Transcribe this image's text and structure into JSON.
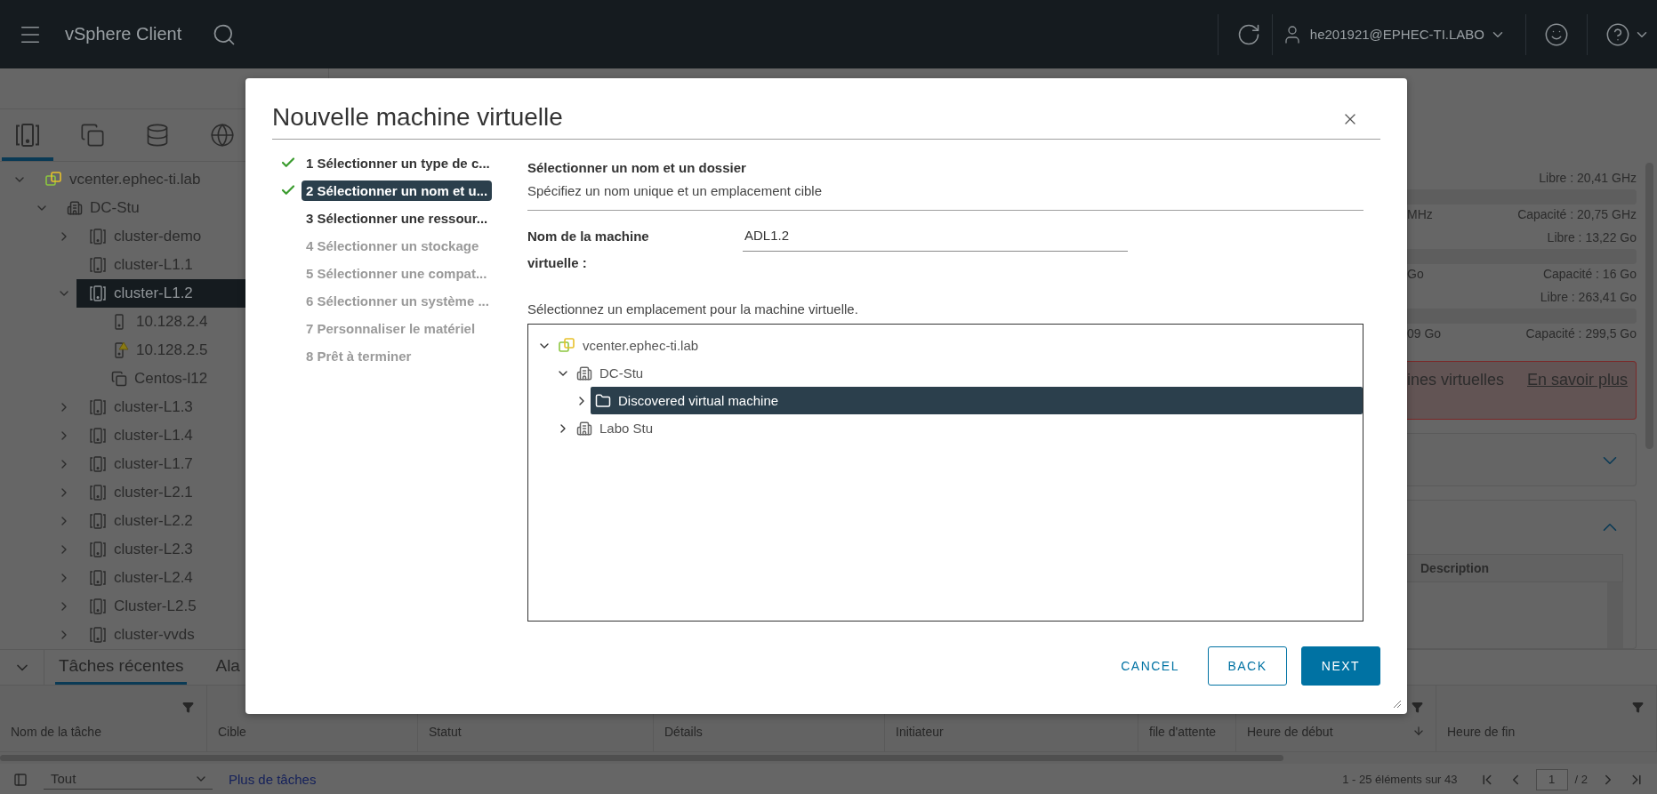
{
  "header": {
    "title": "vSphere Client",
    "user": "he201921@EPHEC-TI.LABO"
  },
  "sidebar": {
    "tabs": [
      {
        "kind": "hosts",
        "selected": true
      },
      {
        "kind": "vms",
        "selected": false
      },
      {
        "kind": "storage",
        "selected": false
      },
      {
        "kind": "network",
        "selected": false
      }
    ],
    "tree": [
      {
        "label": "vcenter.ephec-ti.lab",
        "kind": "vcenter",
        "expanded": true,
        "selected": false,
        "children": [
          {
            "label": "DC-Stu",
            "kind": "datacenter",
            "expanded": true,
            "selected": false,
            "children": [
              {
                "label": "cluster-demo",
                "kind": "cluster",
                "expanded": false,
                "selected": false
              },
              {
                "label": "cluster-L1.1",
                "kind": "cluster",
                "selected": false
              },
              {
                "label": "cluster-L1.2",
                "kind": "cluster",
                "expanded": true,
                "selected": true,
                "children": [
                  {
                    "label": "10.128.2.4",
                    "kind": "host",
                    "selected": false
                  },
                  {
                    "label": "10.128.2.5",
                    "kind": "host-warning",
                    "selected": false
                  },
                  {
                    "label": "Centos-l12",
                    "kind": "vm",
                    "selected": false
                  }
                ]
              },
              {
                "label": "cluster-L1.3",
                "kind": "cluster",
                "expanded": false,
                "selected": false
              },
              {
                "label": "cluster-L1.4",
                "kind": "cluster",
                "expanded": false,
                "selected": false
              },
              {
                "label": "cluster-L1.7",
                "kind": "cluster",
                "expanded": false,
                "selected": false
              },
              {
                "label": "cluster-L2.1",
                "kind": "cluster",
                "expanded": false,
                "selected": false
              },
              {
                "label": "cluster-L2.2",
                "kind": "cluster",
                "expanded": false,
                "selected": false
              },
              {
                "label": "cluster-L2.3",
                "kind": "cluster",
                "expanded": false,
                "selected": false
              },
              {
                "label": "cluster-L2.4",
                "kind": "cluster",
                "expanded": false,
                "selected": false
              },
              {
                "label": "Cluster-L2.5",
                "kind": "cluster",
                "expanded": false,
                "selected": false
              },
              {
                "label": "cluster-vvds",
                "kind": "cluster",
                "expanded": false,
                "selected": false
              }
            ]
          }
        ]
      }
    ]
  },
  "right_panel": {
    "resources": [
      {
        "free": "Libre : 20,41 GHz",
        "used": "MHz",
        "capacity": "Capacité : 20,75 GHz"
      },
      {
        "free": "Libre : 13,22 Go",
        "used": "Go",
        "capacity": "Capacité : 16 Go"
      },
      {
        "free": "Libre : 263,41 Go",
        "used": "09 Go",
        "capacity": "Capacité : 299,5 Go"
      }
    ],
    "alert": {
      "text": "ines virtuelles",
      "link": "En savoir plus"
    },
    "cards": [
      {
        "expanded": false
      },
      {
        "expanded": true,
        "columns": [
          "Description"
        ]
      }
    ]
  },
  "tasks_panel": {
    "tabs": [
      {
        "label": "Tâches récentes",
        "selected": true
      },
      {
        "label": "Ala",
        "selected": false
      }
    ],
    "columns": [
      {
        "label": "Nom de la tâche",
        "filterable": true,
        "sorted": false
      },
      {
        "label": "Cible",
        "sorted": false
      },
      {
        "label": "Statut",
        "sorted": false
      },
      {
        "label": "Détails",
        "sorted": false
      },
      {
        "label": "Initiateur",
        "sorted": false
      },
      {
        "label": "file d'attente",
        "sorted": false
      },
      {
        "label": "Heure de début",
        "filterable": true,
        "sorted": true
      },
      {
        "label": "Heure de fin",
        "filterable": true,
        "sorted": false
      }
    ],
    "filter": "Tout",
    "more_link": "Plus de tâches",
    "range": "1 - 25 éléments sur 43",
    "page": "1",
    "pages": "/ 2"
  },
  "dialog": {
    "title": "Nouvelle machine virtuelle",
    "steps": [
      {
        "label": "1 Sélectionner un type de c...",
        "completed": true,
        "selected": false,
        "disabled": false
      },
      {
        "label": "2 Sélectionner un nom et u...",
        "completed": true,
        "selected": true,
        "disabled": false
      },
      {
        "label": "3 Sélectionner une ressour...",
        "completed": false,
        "selected": false,
        "disabled": false
      },
      {
        "label": "4 Sélectionner un stockage",
        "completed": false,
        "selected": false,
        "disabled": true
      },
      {
        "label": "5 Sélectionner une compat...",
        "completed": false,
        "selected": false,
        "disabled": true
      },
      {
        "label": "6 Sélectionner un système ...",
        "completed": false,
        "selected": false,
        "disabled": true
      },
      {
        "label": "7 Personnaliser le matériel",
        "completed": false,
        "selected": false,
        "disabled": true
      },
      {
        "label": "8 Prêt à terminer",
        "completed": false,
        "selected": false,
        "disabled": true
      }
    ],
    "heading": "Sélectionner un nom et un dossier",
    "description": "Spécifiez un nom unique et un emplacement cible",
    "name_label": "Nom de la machine virtuelle :",
    "name_value": "ADL1.2",
    "location_label": "Sélectionnez un emplacement pour la machine virtuelle.",
    "locations": [
      {
        "label": "vcenter.ephec-ti.lab",
        "kind": "vcenter",
        "expanded": true,
        "selected": false,
        "children": [
          {
            "label": "DC-Stu",
            "kind": "datacenter",
            "expanded": true,
            "selected": false,
            "children": [
              {
                "label": "Discovered virtual machine",
                "kind": "folder",
                "expanded": false,
                "selected": true
              }
            ]
          },
          {
            "label": "Labo Stu",
            "kind": "datacenter",
            "expanded": false,
            "selected": false
          }
        ]
      }
    ],
    "buttons": [
      {
        "label": "CANCEL",
        "kind": "link"
      },
      {
        "label": "BACK",
        "kind": "outline"
      },
      {
        "label": "NEXT",
        "kind": "primary"
      }
    ]
  }
}
